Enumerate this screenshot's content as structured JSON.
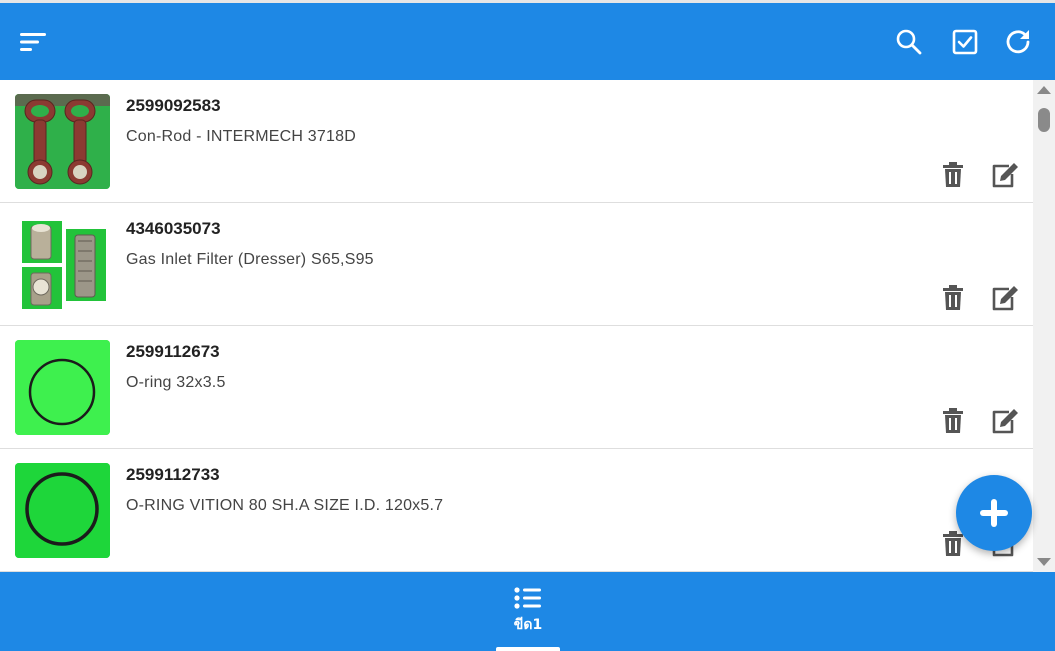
{
  "header": {
    "bg_color": "#1e88e5",
    "icons": [
      "filter-menu-icon",
      "search-icon",
      "checkbox-icon",
      "refresh-icon"
    ]
  },
  "items": [
    {
      "code": "2599092583",
      "description": "Con-Rod - INTERMECH 3718D",
      "thumb": "con-rod-photo"
    },
    {
      "code": "4346035073",
      "description": "Gas Inlet Filter (Dresser) S65,S95",
      "thumb": "gas-filter-photo"
    },
    {
      "code": "2599112673",
      "description": "O-ring 32x3.5",
      "thumb": "o-ring-photo"
    },
    {
      "code": "2599112733",
      "description": "O-RING VITION 80 SH.A SIZE I.D. 120x5.7",
      "thumb": "o-ring-photo"
    }
  ],
  "fab": {
    "icon": "plus-icon"
  },
  "bottom_nav": {
    "tabs": [
      {
        "label": "ขีด1",
        "icon": "list-icon",
        "active": true
      }
    ]
  }
}
